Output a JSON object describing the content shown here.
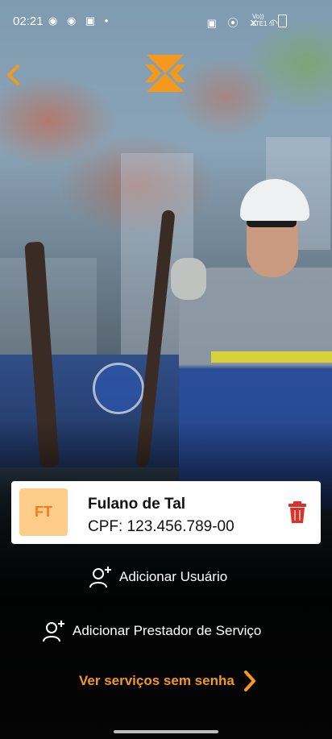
{
  "status_bar": {
    "time": "02:21",
    "left_icons": "◉ ◉ ▣ •",
    "right_icons": "▣ ⦿ ✕ ◠",
    "network_line1": "Vo))",
    "network_line2": "LTE1 .ıl"
  },
  "header": {
    "back_icon": "chevron-left-icon",
    "logo": "brand-logo",
    "accent_color": "#f39a1e"
  },
  "user_card": {
    "initials": "FT",
    "name": "Fulano de Tal",
    "cpf": "CPF: 123.456.789-00",
    "delete_icon": "trash-icon",
    "delete_color": "#d9322b"
  },
  "actions": {
    "add_user_label": "Adicionar Usuário",
    "add_provider_label": "Adicionar Prestador de Serviço",
    "services_link_label": "Ver serviços sem senha"
  }
}
